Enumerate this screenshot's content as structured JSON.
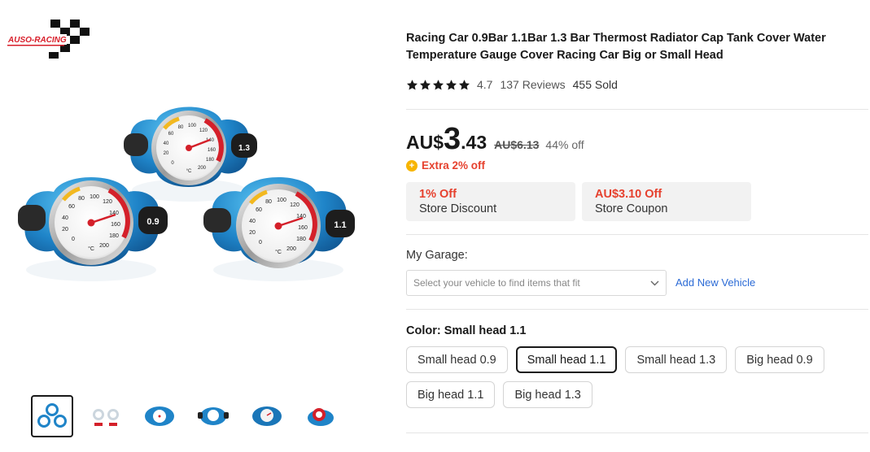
{
  "brand": {
    "logo_text": "AUSO-RACING"
  },
  "gallery": {
    "main_image_alt": "",
    "gauge_labels": [
      "0.9",
      "1.3",
      "1.1"
    ],
    "gauge_scale": [
      "0",
      "20",
      "40",
      "60",
      "80",
      "100",
      "120",
      "140",
      "160",
      "180",
      "200",
      "°C"
    ],
    "thumbnails": [
      {
        "name": "thumb-three-caps",
        "active": true
      },
      {
        "name": "thumb-two-caps",
        "active": false
      },
      {
        "name": "thumb-cap-front",
        "active": false
      },
      {
        "name": "thumb-cap-small",
        "active": false
      },
      {
        "name": "thumb-cap-blue",
        "active": false
      },
      {
        "name": "thumb-cap-red",
        "active": false
      }
    ]
  },
  "product": {
    "title": "Racing Car 0.9Bar 1.1Bar 1.3 Bar Thermost Radiator Cap Tank Cover Water Temperature Gauge Cover Racing Car Big or Small Head",
    "rating": "4.7",
    "stars": 5,
    "reviews": "137 Reviews",
    "sold": "455 Sold"
  },
  "price": {
    "currency": "AU$",
    "integer": "3",
    "decimal": ".43",
    "original": "AU$6.13",
    "discount": "44% off",
    "extra": "Extra 2% off"
  },
  "coupons": [
    {
      "top": "1% Off",
      "bottom": "Store Discount"
    },
    {
      "top": "AU$3.10 Off",
      "bottom": "Store Coupon"
    }
  ],
  "garage": {
    "label": "My Garage:",
    "placeholder": "Select your vehicle to find items that fit",
    "add_label": "Add New Vehicle"
  },
  "color": {
    "label": "Color: Small head 1.1",
    "options": [
      "Small head 0.9",
      "Small head 1.1",
      "Small head 1.3",
      "Big head 0.9",
      "Big head 1.1",
      "Big head 1.3"
    ],
    "selected_index": 1
  },
  "colors": {
    "accent_red": "#e6412e",
    "link_blue": "#2c6bd6",
    "cap_blue": "#1f7fc4",
    "star": "#191919"
  }
}
